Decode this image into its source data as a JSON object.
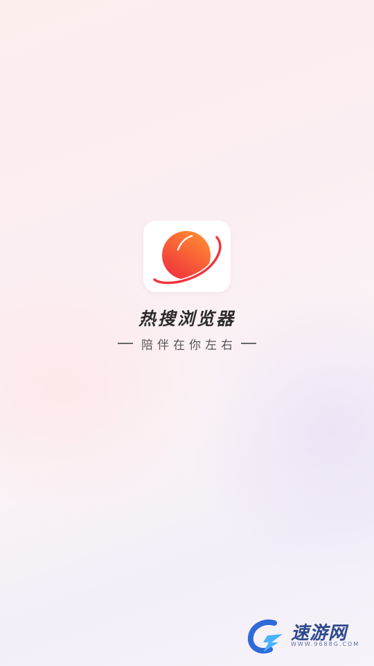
{
  "splash": {
    "app_name": "热搜浏览器",
    "slogan": "陪伴在你左右"
  },
  "watermark": {
    "name": "速游网",
    "url": "WWW.9688G.COM"
  },
  "colors": {
    "brand_red": "#f23c3c",
    "brand_orange": "#ff7a2f",
    "title_text": "#2b2b2b",
    "watermark_blue": "#2d4a8c"
  },
  "icons": {
    "app_logo": "planet-icon",
    "watermark_logo": "lightning-g-icon"
  }
}
